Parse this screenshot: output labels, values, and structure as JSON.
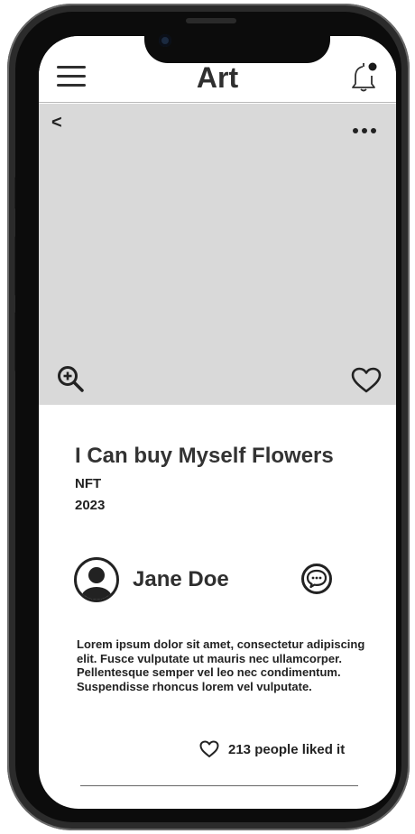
{
  "header": {
    "title": "Art",
    "menu_icon": "hamburger-menu-icon",
    "notification_icon": "bell-icon"
  },
  "artwork": {
    "back_icon": "back-chevron-icon",
    "back_glyph": "<",
    "more_icon": "more-dots-icon",
    "zoom_icon": "zoom-in-icon",
    "favorite_icon": "heart-icon",
    "title": "I Can buy Myself Flowers",
    "type": "NFT",
    "year": "2023"
  },
  "artist": {
    "name": "Jane Doe",
    "avatar_icon": "user-avatar-icon",
    "chat_icon": "chat-bubble-icon"
  },
  "description": "Lorem ipsum dolor sit amet, consectetur adipiscing elit. Fusce vulputate ut mauris nec ullamcorper. Pellentesque semper vel leo nec condimentum. Suspendisse rhoncus lorem vel vulputate.",
  "likes": {
    "text": "213 people liked it",
    "icon": "heart-outline-icon"
  },
  "colors": {
    "image_placeholder": "#d9d9d9",
    "text": "#222222",
    "frame": "#0c0c0c"
  }
}
